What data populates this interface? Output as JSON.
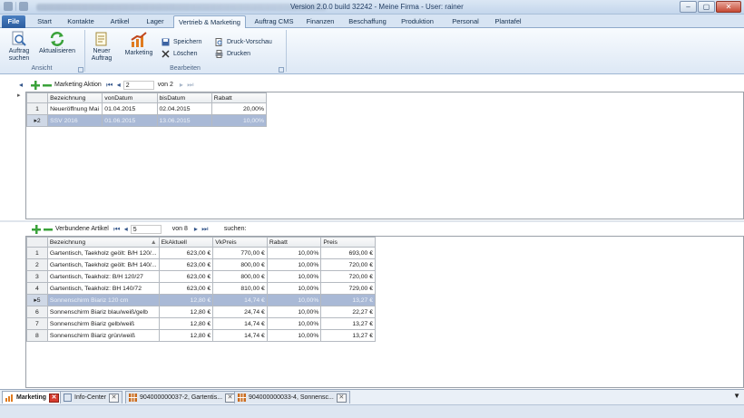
{
  "window": {
    "title": "Version 2.0.0  build 32242 - Meine Firma - User: rainer",
    "minimize": "–",
    "maximize": "▢",
    "close": "✕"
  },
  "ribbon_tabs": [
    {
      "label": "File"
    },
    {
      "label": "Start"
    },
    {
      "label": "Kontakte"
    },
    {
      "label": "Artikel"
    },
    {
      "label": "Lager"
    },
    {
      "label": "Vertrieb & Marketing",
      "active": true
    },
    {
      "label": "Auftrag CMS"
    },
    {
      "label": "Finanzen"
    },
    {
      "label": "Beschaffung"
    },
    {
      "label": "Produktion"
    },
    {
      "label": "Personal"
    },
    {
      "label": "Plantafel"
    }
  ],
  "ribbon": {
    "auftrag_suchen": "Auftrag suchen",
    "aktualisieren": "Aktualisieren",
    "group_ansicht": "Ansicht",
    "neuer_auftrag": "Neuer Auftrag",
    "marketing": "Marketing",
    "speichern": "Speichern",
    "loeschen": "Löschen",
    "druck_vorschau": "Druck-Vorschau",
    "drucken": "Drucken",
    "group_bearbeiten": "Bearbeiten"
  },
  "marketing_nav": {
    "label": "Marketing Aktion",
    "position": "2",
    "of": "von 2"
  },
  "marketing_grid": {
    "columns": [
      "Bezeichnung",
      "vonDatum",
      "bisDatum",
      "Rabatt"
    ],
    "rows": [
      {
        "num": "1",
        "bezeichnung": "Neueröffnung Mai",
        "von": "01.04.2015",
        "bis": "02.04.2015",
        "rabatt": "20,00%"
      },
      {
        "num": "2",
        "bezeichnung": "SSV 2016",
        "von": "01.06.2015",
        "bis": "13.06.2015",
        "rabatt": "10,00%"
      }
    ]
  },
  "articles_nav": {
    "label": "Verbundene Artikel",
    "position": "5",
    "of": "von 8",
    "search_label": "suchen:"
  },
  "articles_grid": {
    "columns": [
      "Bezeichnung",
      "EkAktuell",
      "VkPreis",
      "Rabatt",
      "Preis"
    ],
    "rows": [
      {
        "num": "1",
        "bezeichnung": "Gartentisch, Taekholz geölt: B/H 120/...",
        "ek": "623,00 €",
        "vk": "770,00 €",
        "rabatt": "10,00%",
        "preis": "693,00 €"
      },
      {
        "num": "2",
        "bezeichnung": "Gartentisch, Taekholz geölt: B/H 140/...",
        "ek": "623,00 €",
        "vk": "800,00 €",
        "rabatt": "10,00%",
        "preis": "720,00 €"
      },
      {
        "num": "3",
        "bezeichnung": "Gartentisch, Teakholz: B/H 120/27",
        "ek": "623,00 €",
        "vk": "800,00 €",
        "rabatt": "10,00%",
        "preis": "720,00 €"
      },
      {
        "num": "4",
        "bezeichnung": "Gartentisch, Teakholz: BH 140/72",
        "ek": "623,00 €",
        "vk": "810,00 €",
        "rabatt": "10,00%",
        "preis": "729,00 €"
      },
      {
        "num": "5",
        "bezeichnung": "Sonnenschirm Biariz 120 cm",
        "ek": "12,80 €",
        "vk": "14,74 €",
        "rabatt": "10,00%",
        "preis": "13,27 €"
      },
      {
        "num": "6",
        "bezeichnung": "Sonnenschirm Biariz blau/weiß/gelb",
        "ek": "12,80 €",
        "vk": "24,74 €",
        "rabatt": "10,00%",
        "preis": "22,27 €"
      },
      {
        "num": "7",
        "bezeichnung": "Sonnenschirm Biariz gelb/weiß",
        "ek": "12,80 €",
        "vk": "14,74 €",
        "rabatt": "10,00%",
        "preis": "13,27 €"
      },
      {
        "num": "8",
        "bezeichnung": "Sonnenschirm Biariz grün/weiß",
        "ek": "12,80 €",
        "vk": "14,74 €",
        "rabatt": "10,00%",
        "preis": "13,27 €"
      }
    ]
  },
  "doc_tabs": [
    {
      "label": "Marketing",
      "active": true
    },
    {
      "label": "Info-Center"
    },
    {
      "label": "904000000037-2,  Gartentis..."
    },
    {
      "label": "904000000033-4,  Sonnensc..."
    }
  ],
  "colors": {
    "accent": "#2b5c9e",
    "selection": "#a9b9d6",
    "ribbon_bg": "#dde8f5",
    "add_green": "#3aa23a"
  }
}
